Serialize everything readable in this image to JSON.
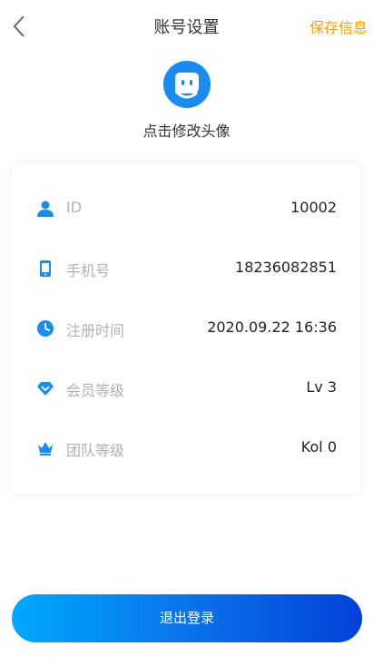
{
  "header": {
    "title": "账号设置",
    "save_label": "保存信息",
    "back_icon": "chevron-left-icon"
  },
  "profile": {
    "avatar_icon": "robot-avatar-icon",
    "avatar_hint": "点击修改头像"
  },
  "account_info": {
    "rows": [
      {
        "icon": "user-icon",
        "label": "ID",
        "value": "10002"
      },
      {
        "icon": "phone-icon",
        "label": "手机号",
        "value": "18236082851"
      },
      {
        "icon": "clock-icon",
        "label": "注册时间",
        "value": "2020.09.22 16:36"
      },
      {
        "icon": "diamond-icon",
        "label": "会员等级",
        "value": "Lv 3"
      },
      {
        "icon": "crown-icon",
        "label": "团队等级",
        "value": "Kol 0"
      }
    ]
  },
  "footer": {
    "logout_label": "退出登录"
  },
  "colors": {
    "accent_blue": "#1a8cf0",
    "save_orange": "#f4a20f",
    "gradient_start": "#00a8ff",
    "gradient_end": "#0340d8"
  }
}
